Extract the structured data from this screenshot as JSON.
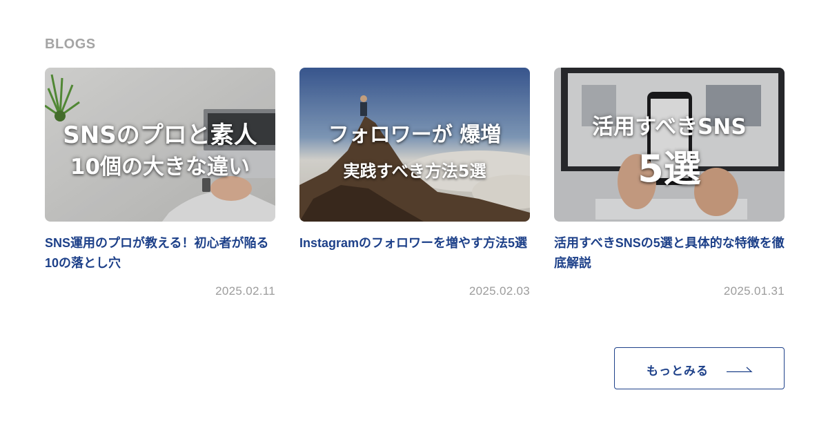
{
  "section": {
    "label": "BLOGS"
  },
  "posts": [
    {
      "overlay_line1": "SNSのプロと素人",
      "overlay_line2": "10個の大きな違い",
      "title": "SNS運用のプロが教える！初心者が陥る10の落とし穴",
      "date": "2025.02.11"
    },
    {
      "overlay_line1": "フォロワーが 爆増",
      "overlay_line2": "実践すべき方法5選",
      "title": "Instagramのフォロワーを増やす方法5選",
      "date": "2025.02.03"
    },
    {
      "overlay_line1": "活用すべきSNS",
      "overlay_line2": "5選",
      "title": "活用すべきSNSの5選と具体的な特徴を徹底解説",
      "date": "2025.01.31"
    }
  ],
  "more": {
    "label": "もっとみる"
  },
  "colors": {
    "title": "#1d4089",
    "date": "#9c9c9c",
    "section_label": "#a4a4a4",
    "button_border": "#1d4089"
  },
  "icons": {
    "more_arrow": "long-right-arrow-icon"
  }
}
